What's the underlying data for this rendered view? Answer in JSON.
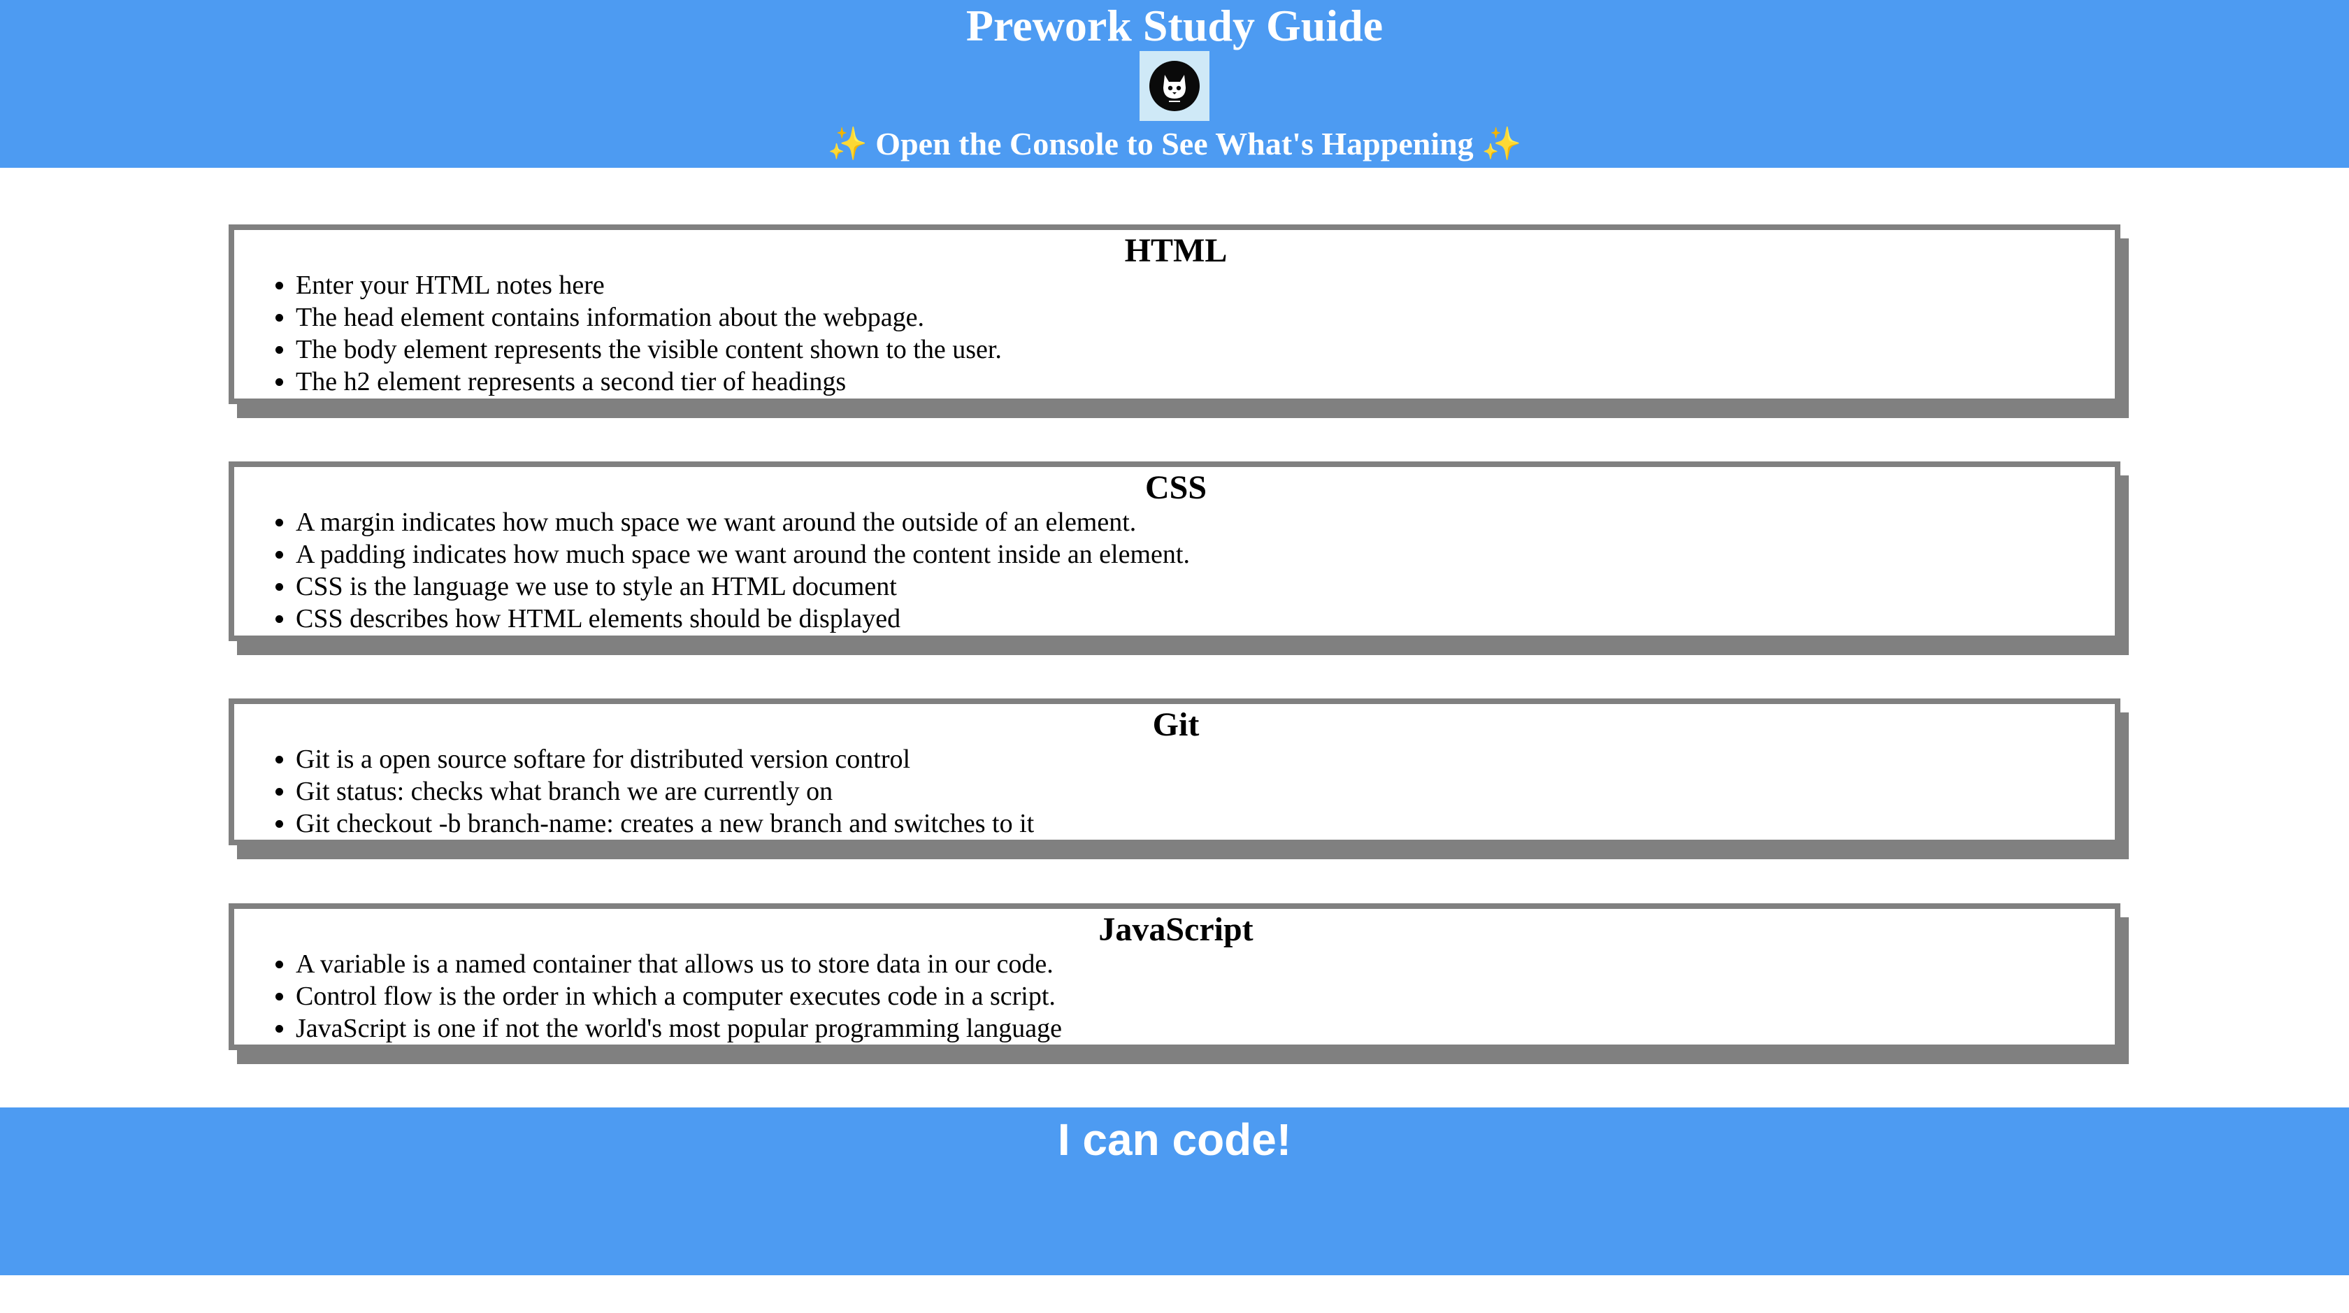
{
  "header": {
    "title": "Prework Study Guide",
    "sparkle_left": "✨",
    "console_note": "Open the Console to See What's Happening",
    "sparkle_right": "✨"
  },
  "sections": [
    {
      "heading": "HTML",
      "items": [
        "Enter your HTML notes here",
        "The head element contains information about the webpage.",
        "The body element represents the visible content shown to the user.",
        "The h2 element represents a second tier of headings"
      ]
    },
    {
      "heading": "CSS",
      "items": [
        "A margin indicates how much space we want around the outside of an element.",
        "A padding indicates how much space we want around the content inside an element.",
        "CSS is the language we use to style an HTML document",
        "CSS describes how HTML elements should be displayed"
      ]
    },
    {
      "heading": "Git",
      "items": [
        "Git is a open source softare for distributed version control",
        "Git status: checks what branch we are currently on",
        "Git checkout -b branch-name: creates a new branch and switches to it"
      ]
    },
    {
      "heading": "JavaScript",
      "items": [
        "A variable is a named container that allows us to store data in our code.",
        "Control flow is the order in which a computer executes code in a script.",
        "JavaScript is one if not the world's most popular programming language"
      ]
    }
  ],
  "footer": {
    "text": "I can code!"
  },
  "colors": {
    "banner": "#4d9bf2",
    "card_border": "#808080",
    "sparkle": "#f5d142"
  },
  "icons": {
    "logo": "cat-face-logo-icon"
  }
}
